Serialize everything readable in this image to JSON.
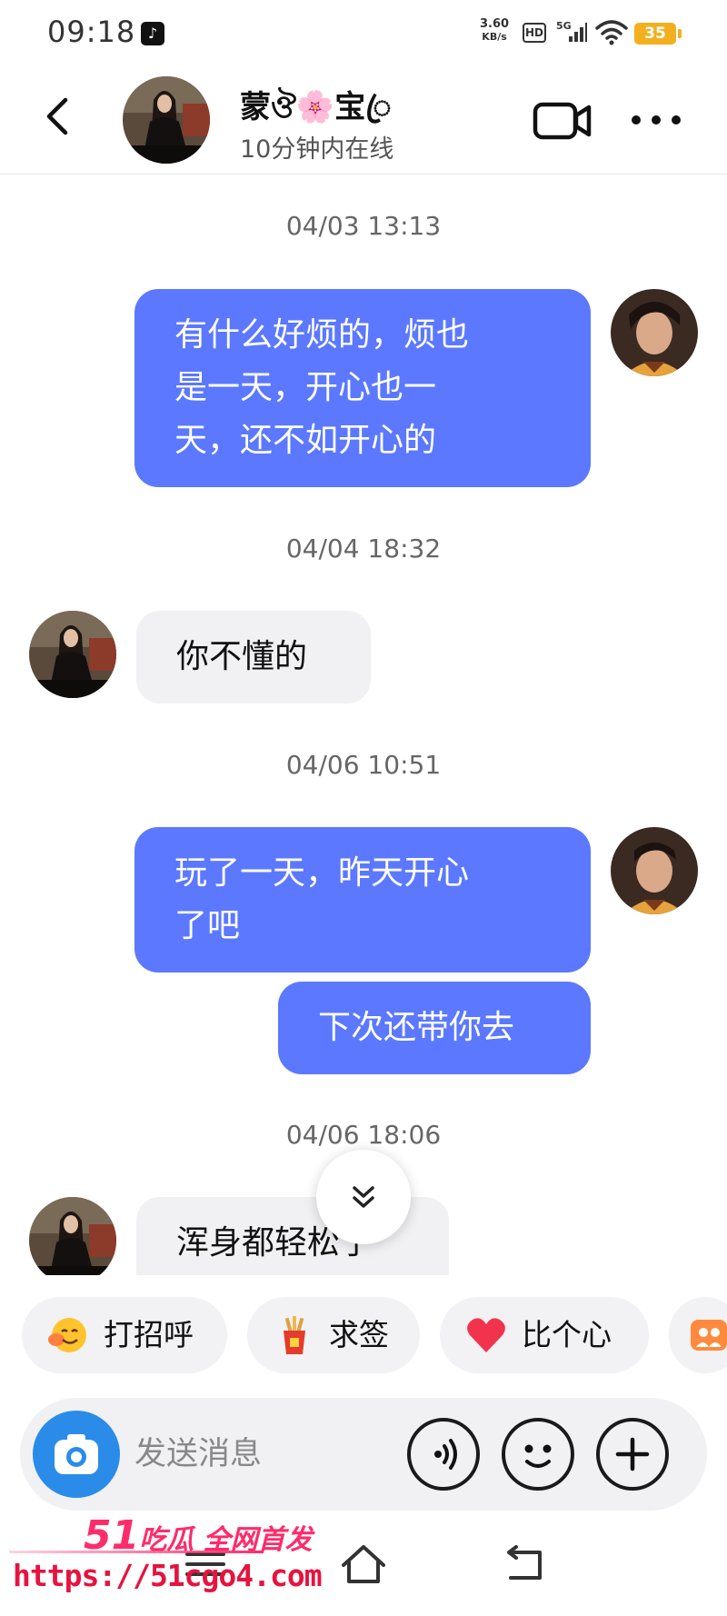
{
  "status_bar": {
    "time": "09:18",
    "net_speed_value": "3.60",
    "net_speed_unit": "KB/s",
    "hd": "HD",
    "network": "5G",
    "battery": "35"
  },
  "header": {
    "contact_name": "蒙ঔ🌸宝ꦿ",
    "online_status": "10分钟内在线"
  },
  "messages": [
    {
      "timestamp": "04/03 13:13"
    },
    {
      "direction": "out",
      "lines": [
        "有什么好烦的，烦也",
        "是一天，开心也一",
        "天，还不如开心的"
      ]
    },
    {
      "timestamp": "04/04 18:32"
    },
    {
      "direction": "in",
      "lines": [
        "你不懂的"
      ]
    },
    {
      "timestamp": "04/06 10:51"
    },
    {
      "direction": "out",
      "lines": [
        "玩了一天，昨天开心",
        "了吧"
      ]
    },
    {
      "direction": "out",
      "lines": [
        "下次还带你去"
      ]
    },
    {
      "timestamp": "04/06 18:06"
    },
    {
      "direction": "in",
      "lines": [
        "浑身都轻松了"
      ]
    }
  ],
  "quick_replies": [
    {
      "label": "打招呼",
      "icon": "smile-emoji-icon"
    },
    {
      "label": "求签",
      "icon": "fortune-sticks-icon"
    },
    {
      "label": "比个心",
      "icon": "heart-icon"
    },
    {
      "label": "",
      "icon": "group-photo-icon"
    }
  ],
  "input": {
    "placeholder": "发送消息"
  },
  "watermark": {
    "brand_number": "51",
    "brand_text": "吃瓜 全网首发",
    "url": "https://51cgo4.com"
  },
  "colors": {
    "outgoing_bubble": "#5b78ff",
    "incoming_bubble": "#f1f1f3",
    "camera_button": "#2a8ce8",
    "battery": "#f2b01e",
    "watermark": "#ff2b6a"
  }
}
